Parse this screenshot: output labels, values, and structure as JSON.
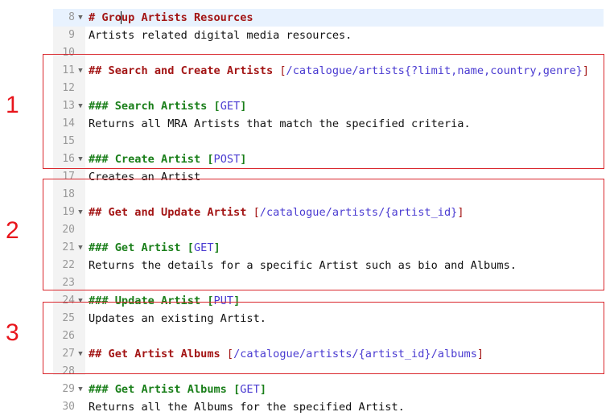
{
  "lines": [
    {
      "n": "8",
      "fold": true,
      "active": true,
      "parts": [
        {
          "t": "# Gro",
          "c": "h1"
        },
        {
          "t": "",
          "c": "cursor"
        },
        {
          "t": "up Artists Resources",
          "c": "h1"
        }
      ]
    },
    {
      "n": "9",
      "fold": false,
      "parts": [
        {
          "t": "Artists related digital media resources.",
          "c": "text"
        }
      ]
    },
    {
      "n": "10",
      "fold": false,
      "parts": []
    },
    {
      "n": "11",
      "fold": true,
      "parts": [
        {
          "t": "## Search and Create Artists ",
          "c": "h2"
        },
        {
          "t": "[",
          "c": "bracket"
        },
        {
          "t": "/catalogue/artists{?limit,name,country,genre}",
          "c": "uri"
        },
        {
          "t": "]",
          "c": "bracket"
        }
      ]
    },
    {
      "n": "12",
      "fold": false,
      "parts": []
    },
    {
      "n": "13",
      "fold": true,
      "parts": [
        {
          "t": "### Search Artists ",
          "c": "h3"
        },
        {
          "t": "[",
          "c": "h3"
        },
        {
          "t": "GET",
          "c": "uri"
        },
        {
          "t": "]",
          "c": "h3"
        }
      ]
    },
    {
      "n": "14",
      "fold": false,
      "parts": [
        {
          "t": "Returns all MRA Artists that match the specified criteria.",
          "c": "text"
        }
      ]
    },
    {
      "n": "15",
      "fold": false,
      "parts": []
    },
    {
      "n": "16",
      "fold": true,
      "parts": [
        {
          "t": "### Create Artist ",
          "c": "h3"
        },
        {
          "t": "[",
          "c": "h3"
        },
        {
          "t": "POST",
          "c": "uri"
        },
        {
          "t": "]",
          "c": "h3"
        }
      ]
    },
    {
      "n": "17",
      "fold": false,
      "parts": [
        {
          "t": "Creates an Artist",
          "c": "text"
        }
      ]
    },
    {
      "n": "18",
      "fold": false,
      "parts": []
    },
    {
      "n": "19",
      "fold": true,
      "parts": [
        {
          "t": "## Get and Update Artist ",
          "c": "h2"
        },
        {
          "t": "[",
          "c": "bracket"
        },
        {
          "t": "/catalogue/artists/{artist_id}",
          "c": "uri"
        },
        {
          "t": "]",
          "c": "bracket"
        }
      ]
    },
    {
      "n": "20",
      "fold": false,
      "parts": []
    },
    {
      "n": "21",
      "fold": true,
      "parts": [
        {
          "t": "### Get Artist ",
          "c": "h3"
        },
        {
          "t": "[",
          "c": "h3"
        },
        {
          "t": "GET",
          "c": "uri"
        },
        {
          "t": "]",
          "c": "h3"
        }
      ]
    },
    {
      "n": "22",
      "fold": false,
      "parts": [
        {
          "t": "Returns the details for a specific Artist such as bio and Albums.",
          "c": "text"
        }
      ]
    },
    {
      "n": "23",
      "fold": false,
      "parts": []
    },
    {
      "n": "24",
      "fold": true,
      "parts": [
        {
          "t": "### Update Artist ",
          "c": "h3"
        },
        {
          "t": "[",
          "c": "h3"
        },
        {
          "t": "PUT",
          "c": "uri"
        },
        {
          "t": "]",
          "c": "h3"
        }
      ]
    },
    {
      "n": "25",
      "fold": false,
      "parts": [
        {
          "t": "Updates an existing Artist.",
          "c": "text"
        }
      ]
    },
    {
      "n": "26",
      "fold": false,
      "parts": []
    },
    {
      "n": "27",
      "fold": true,
      "parts": [
        {
          "t": "## Get Artist Albums ",
          "c": "h2"
        },
        {
          "t": "[",
          "c": "bracket"
        },
        {
          "t": "/catalogue/artists/{artist_id}/albums",
          "c": "uri"
        },
        {
          "t": "]",
          "c": "bracket"
        }
      ]
    },
    {
      "n": "28",
      "fold": false,
      "parts": []
    },
    {
      "n": "29",
      "fold": true,
      "parts": [
        {
          "t": "### Get Artist Albums ",
          "c": "h3"
        },
        {
          "t": "[",
          "c": "h3"
        },
        {
          "t": "GET",
          "c": "uri"
        },
        {
          "t": "]",
          "c": "h3"
        }
      ]
    },
    {
      "n": "30",
      "fold": false,
      "parts": [
        {
          "t": "Returns all the Albums for the specified Artist.",
          "c": "text"
        }
      ]
    }
  ],
  "fold_icon": "triangle-down-icon",
  "fold_glyph": "▼",
  "annotations": [
    {
      "label": "1"
    },
    {
      "label": "2"
    },
    {
      "label": "3"
    }
  ],
  "colors": {
    "annotation_red": "#e8141b",
    "heading1": "#a31515",
    "heading3": "#1a7f1a",
    "uri": "#4a3bd1",
    "active_line": "#e8f2fe"
  }
}
